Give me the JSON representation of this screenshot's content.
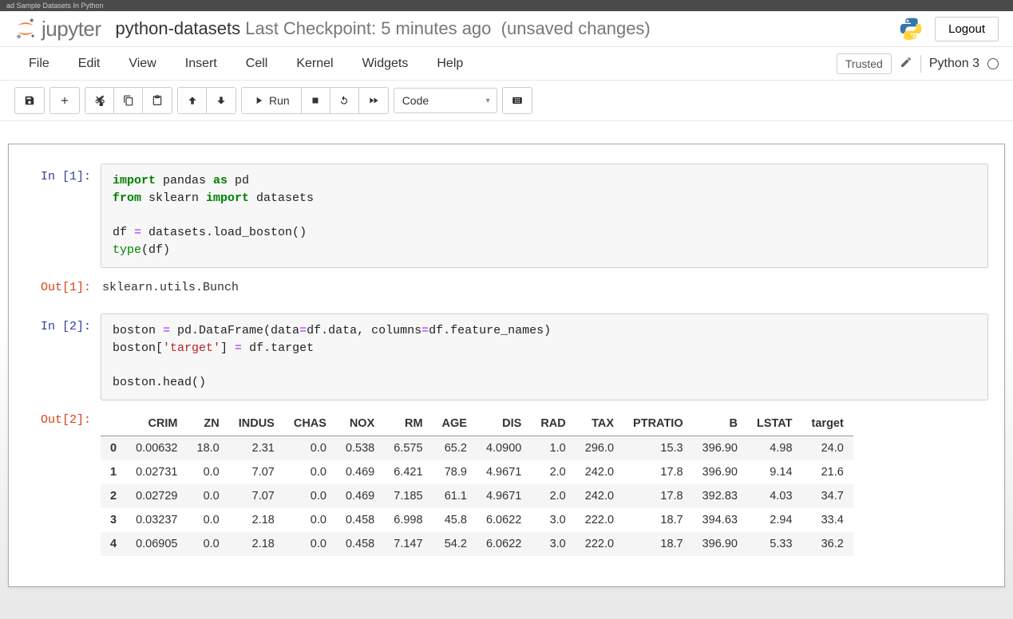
{
  "browser_tab": "ad Sample Datasets In Python",
  "header": {
    "logo_text": "jupyter",
    "notebook_name": "python-datasets",
    "checkpoint": "Last Checkpoint: 5 minutes ago",
    "status_suffix": "(unsaved changes)",
    "logout": "Logout"
  },
  "menubar": {
    "items": [
      "File",
      "Edit",
      "View",
      "Insert",
      "Cell",
      "Kernel",
      "Widgets",
      "Help"
    ],
    "trusted": "Trusted",
    "kernel": "Python 3"
  },
  "toolbar": {
    "run_label": "Run",
    "cell_type": "Code"
  },
  "cells": [
    {
      "in_prompt": "In [1]:",
      "out_prompt": "Out[1]:",
      "code_lines": [
        {
          "tokens": [
            {
              "c": "kw-green",
              "t": "import"
            },
            {
              "t": " pandas "
            },
            {
              "c": "kw-green",
              "t": "as"
            },
            {
              "t": " pd"
            }
          ]
        },
        {
          "tokens": [
            {
              "c": "kw-green",
              "t": "from"
            },
            {
              "t": " sklearn "
            },
            {
              "c": "kw-green",
              "t": "import"
            },
            {
              "t": " datasets"
            }
          ]
        },
        {
          "tokens": [
            {
              "t": ""
            }
          ]
        },
        {
          "tokens": [
            {
              "t": "df "
            },
            {
              "c": "op",
              "t": "="
            },
            {
              "t": " datasets.load_boston()"
            }
          ]
        },
        {
          "tokens": [
            {
              "c": "builtin",
              "t": "type"
            },
            {
              "t": "(df)"
            }
          ]
        }
      ],
      "output_text": "sklearn.utils.Bunch"
    },
    {
      "in_prompt": "In [2]:",
      "out_prompt": "Out[2]:",
      "code_lines": [
        {
          "tokens": [
            {
              "t": "boston "
            },
            {
              "c": "op",
              "t": "="
            },
            {
              "t": " pd.DataFrame(data"
            },
            {
              "c": "op",
              "t": "="
            },
            {
              "t": "df.data, columns"
            },
            {
              "c": "op",
              "t": "="
            },
            {
              "t": "df.feature_names)"
            }
          ]
        },
        {
          "tokens": [
            {
              "t": "boston["
            },
            {
              "c": "str",
              "t": "'target'"
            },
            {
              "t": "] "
            },
            {
              "c": "op",
              "t": "="
            },
            {
              "t": " df.target"
            }
          ]
        },
        {
          "tokens": [
            {
              "t": ""
            }
          ]
        },
        {
          "tokens": [
            {
              "t": "boston.head()"
            }
          ]
        }
      ],
      "dataframe": {
        "columns": [
          "CRIM",
          "ZN",
          "INDUS",
          "CHAS",
          "NOX",
          "RM",
          "AGE",
          "DIS",
          "RAD",
          "TAX",
          "PTRATIO",
          "B",
          "LSTAT",
          "target"
        ],
        "index": [
          "0",
          "1",
          "2",
          "3",
          "4"
        ],
        "rows": [
          [
            "0.00632",
            "18.0",
            "2.31",
            "0.0",
            "0.538",
            "6.575",
            "65.2",
            "4.0900",
            "1.0",
            "296.0",
            "15.3",
            "396.90",
            "4.98",
            "24.0"
          ],
          [
            "0.02731",
            "0.0",
            "7.07",
            "0.0",
            "0.469",
            "6.421",
            "78.9",
            "4.9671",
            "2.0",
            "242.0",
            "17.8",
            "396.90",
            "9.14",
            "21.6"
          ],
          [
            "0.02729",
            "0.0",
            "7.07",
            "0.0",
            "0.469",
            "7.185",
            "61.1",
            "4.9671",
            "2.0",
            "242.0",
            "17.8",
            "392.83",
            "4.03",
            "34.7"
          ],
          [
            "0.03237",
            "0.0",
            "2.18",
            "0.0",
            "0.458",
            "6.998",
            "45.8",
            "6.0622",
            "3.0",
            "222.0",
            "18.7",
            "394.63",
            "2.94",
            "33.4"
          ],
          [
            "0.06905",
            "0.0",
            "2.18",
            "0.0",
            "0.458",
            "7.147",
            "54.2",
            "6.0622",
            "3.0",
            "222.0",
            "18.7",
            "396.90",
            "5.33",
            "36.2"
          ]
        ]
      }
    }
  ]
}
